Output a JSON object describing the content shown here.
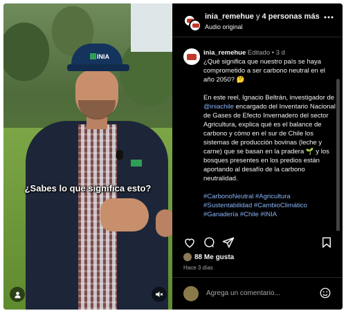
{
  "video": {
    "caption": "¿Sabes lo que significa esto?",
    "cap_logo": "INIA",
    "user_button_icon": "user-icon",
    "mute_button_icon": "muted-speaker-icon"
  },
  "header": {
    "username": "inia_remehue",
    "connector": " y ",
    "others": "4 personas más",
    "audio": "Audio original",
    "more_icon": "more-horizontal-icon"
  },
  "post": {
    "username": "inia_remehue",
    "edited": "Editado",
    "dot": "•",
    "time": "3 d",
    "question": "¿Qué significa que nuestro país se haya comprometido a ser carbono neutral en el año 2050? 🤔",
    "body_before": "En este reel, Ignacio Beltrán, investigador de ",
    "mention": "@iniachile",
    "body_after": " encargado del Inventario Nacional de Gases de Efecto Invernadero del sector Agricultura, explica qué es el balance de carbono y cómo en el sur de Chile los sistemas de producción bovinas (leche y carne) que se basan en la pradera 🌱 y los bosques presentes en los predios están aportando al desafío de la carbono neutralidad.",
    "hashtags": "#CarbonoNeutral #Agricultura #Sustentabilidad #CambioClimático #Ganadería #Chile #INIA"
  },
  "actions": {
    "like_icon": "heart-icon",
    "comment_icon": "comment-icon",
    "share_icon": "share-icon",
    "save_icon": "bookmark-icon"
  },
  "likes": {
    "text": "88 Me gusta"
  },
  "timestamp": "Hace 3 días",
  "comment_box": {
    "placeholder": "Agrega un comentario...",
    "emoji_icon": "smiley-icon"
  },
  "colors": {
    "background": "#000000",
    "text": "#f5f5f5",
    "muted": "#a8a8a8",
    "link": "#8ab4f8"
  }
}
